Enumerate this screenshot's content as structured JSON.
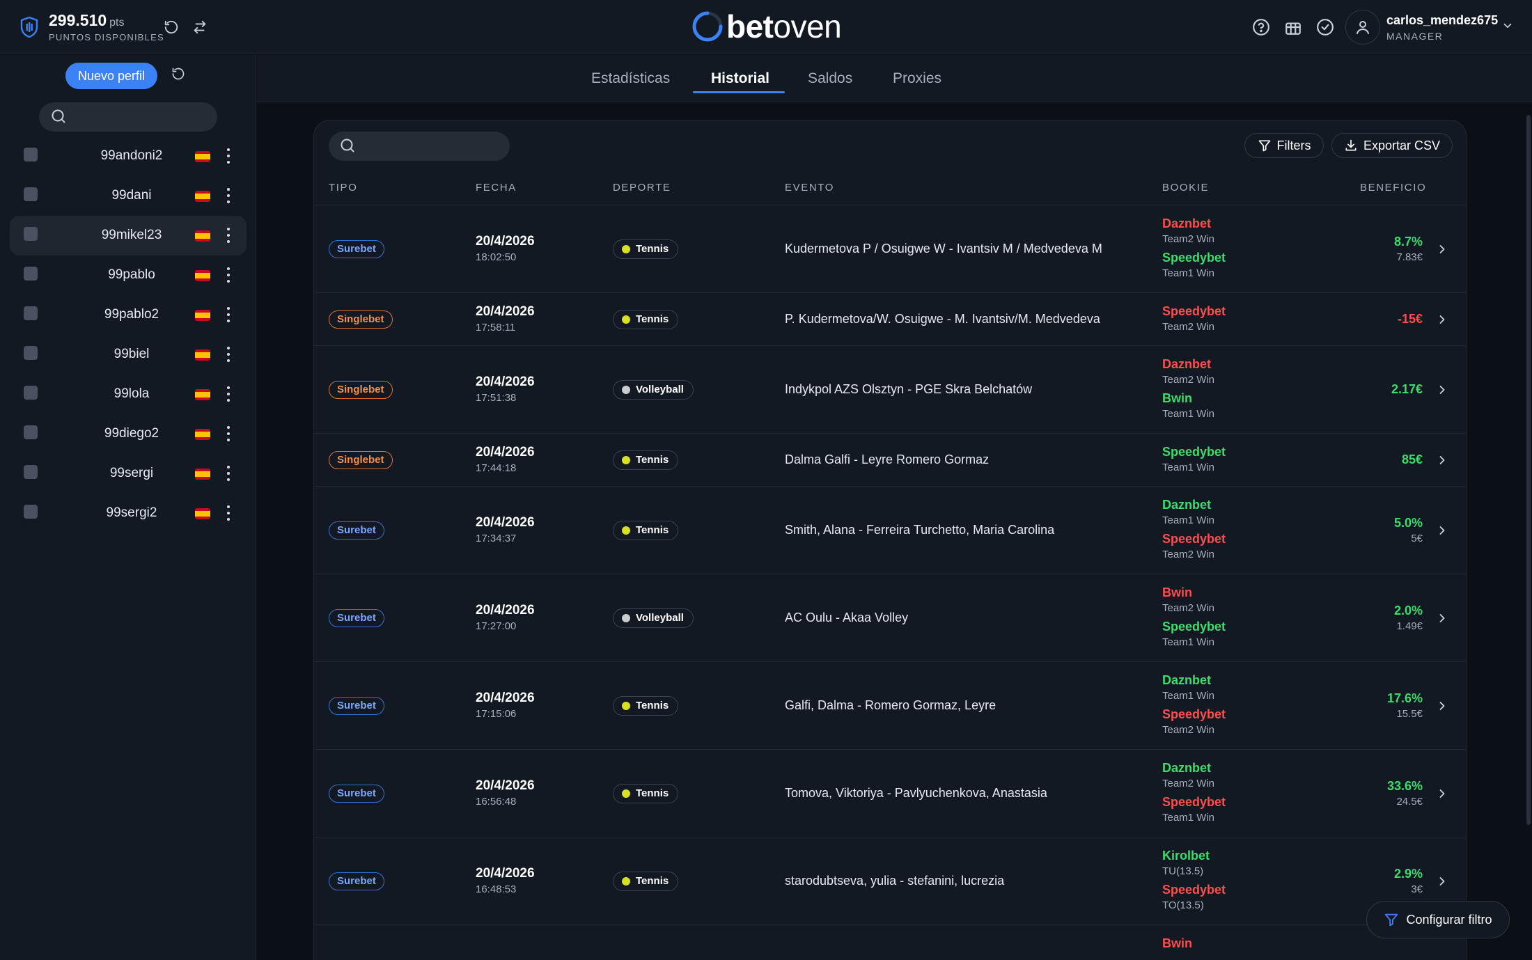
{
  "header": {
    "points_value": "299.510",
    "points_unit": "pts",
    "points_label": "PUNTOS DISPONIBLES",
    "logo_bold": "bet",
    "logo_rest": "oven",
    "user_name": "carlos_mendez675",
    "user_role": "MANAGER"
  },
  "sidebar": {
    "new_profile_label": "Nuevo perfil",
    "search_placeholder": "",
    "profiles": [
      {
        "name": "99andoni2",
        "active": false
      },
      {
        "name": "99dani",
        "active": false
      },
      {
        "name": "99mikel23",
        "active": true
      },
      {
        "name": "99pablo",
        "active": false
      },
      {
        "name": "99pablo2",
        "active": false
      },
      {
        "name": "99biel",
        "active": false
      },
      {
        "name": "99lola",
        "active": false
      },
      {
        "name": "99diego2",
        "active": false
      },
      {
        "name": "99sergi",
        "active": false
      },
      {
        "name": "99sergi2",
        "active": false
      }
    ]
  },
  "tabs": [
    {
      "label": "Estadísticas",
      "active": false
    },
    {
      "label": "Historial",
      "active": true
    },
    {
      "label": "Saldos",
      "active": false
    },
    {
      "label": "Proxies",
      "active": false
    }
  ],
  "toolbar": {
    "search_placeholder": "",
    "filters_label": "Filters",
    "export_label": "Exportar CSV"
  },
  "table": {
    "headers": {
      "tipo": "TIPO",
      "fecha": "FECHA",
      "deporte": "DEPORTE",
      "evento": "EVENTO",
      "bookie": "BOOKIE",
      "beneficio": "BENEFICIO"
    },
    "rows": [
      {
        "type": "Surebet",
        "date": "20/4/2026",
        "time": "18:02:50",
        "sport": "Tennis",
        "event": "Kudermetova P / Osuigwe W - Ivantsiv M / Medvedeva M",
        "bookies": [
          {
            "name": "Daznbet",
            "pick": "Team2 Win",
            "color": "red"
          },
          {
            "name": "Speedybet",
            "pick": "Team1 Win",
            "color": "green"
          }
        ],
        "profit": "8.7%",
        "profit_color": "green",
        "profit_sub": "7.83€"
      },
      {
        "type": "Singlebet",
        "date": "20/4/2026",
        "time": "17:58:11",
        "sport": "Tennis",
        "event": "P. Kudermetova/W. Osuigwe - M. Ivantsiv/M. Medvedeva",
        "bookies": [
          {
            "name": "Speedybet",
            "pick": "Team2 Win",
            "color": "red"
          }
        ],
        "profit": "-15€",
        "profit_color": "red",
        "profit_sub": ""
      },
      {
        "type": "Singlebet",
        "date": "20/4/2026",
        "time": "17:51:38",
        "sport": "Volleyball",
        "event": "Indykpol AZS Olsztyn - PGE Skra Belchatów",
        "bookies": [
          {
            "name": "Daznbet",
            "pick": "Team2 Win",
            "color": "red"
          },
          {
            "name": "Bwin",
            "pick": "Team1 Win",
            "color": "green"
          }
        ],
        "profit": "2.17€",
        "profit_color": "green",
        "profit_sub": ""
      },
      {
        "type": "Singlebet",
        "date": "20/4/2026",
        "time": "17:44:18",
        "sport": "Tennis",
        "event": "Dalma Galfi - Leyre Romero Gormaz",
        "bookies": [
          {
            "name": "Speedybet",
            "pick": "Team1 Win",
            "color": "green"
          }
        ],
        "profit": "85€",
        "profit_color": "green",
        "profit_sub": ""
      },
      {
        "type": "Surebet",
        "date": "20/4/2026",
        "time": "17:34:37",
        "sport": "Tennis",
        "event": "Smith, Alana - Ferreira Turchetto, Maria Carolina",
        "bookies": [
          {
            "name": "Daznbet",
            "pick": "Team1 Win",
            "color": "green"
          },
          {
            "name": "Speedybet",
            "pick": "Team2 Win",
            "color": "red"
          }
        ],
        "profit": "5.0%",
        "profit_color": "green",
        "profit_sub": "5€"
      },
      {
        "type": "Surebet",
        "date": "20/4/2026",
        "time": "17:27:00",
        "sport": "Volleyball",
        "event": "AC Oulu - Akaa Volley",
        "bookies": [
          {
            "name": "Bwin",
            "pick": "Team2 Win",
            "color": "red"
          },
          {
            "name": "Speedybet",
            "pick": "Team1 Win",
            "color": "green"
          }
        ],
        "profit": "2.0%",
        "profit_color": "green",
        "profit_sub": "1.49€"
      },
      {
        "type": "Surebet",
        "date": "20/4/2026",
        "time": "17:15:06",
        "sport": "Tennis",
        "event": "Galfi, Dalma - Romero Gormaz, Leyre",
        "bookies": [
          {
            "name": "Daznbet",
            "pick": "Team1 Win",
            "color": "green"
          },
          {
            "name": "Speedybet",
            "pick": "Team2 Win",
            "color": "red"
          }
        ],
        "profit": "17.6%",
        "profit_color": "green",
        "profit_sub": "15.5€"
      },
      {
        "type": "Surebet",
        "date": "20/4/2026",
        "time": "16:56:48",
        "sport": "Tennis",
        "event": "Tomova, Viktoriya - Pavlyuchenkova, Anastasia",
        "bookies": [
          {
            "name": "Daznbet",
            "pick": "Team2 Win",
            "color": "green"
          },
          {
            "name": "Speedybet",
            "pick": "Team1 Win",
            "color": "red"
          }
        ],
        "profit": "33.6%",
        "profit_color": "green",
        "profit_sub": "24.5€"
      },
      {
        "type": "Surebet",
        "date": "20/4/2026",
        "time": "16:48:53",
        "sport": "Tennis",
        "event": "starodubtseva, yulia - stefanini, lucrezia",
        "bookies": [
          {
            "name": "Kirolbet",
            "pick": "TU(13.5)",
            "color": "green"
          },
          {
            "name": "Speedybet",
            "pick": "TO(13.5)",
            "color": "red"
          }
        ],
        "profit": "2.9%",
        "profit_color": "green",
        "profit_sub": "3€"
      },
      {
        "type": "",
        "date": "",
        "time": "",
        "sport": "",
        "event": "",
        "bookies": [
          {
            "name": "Bwin",
            "pick": "",
            "color": "red"
          }
        ],
        "profit": "",
        "profit_color": "green",
        "profit_sub": ""
      }
    ]
  },
  "floating": {
    "config_filter_label": "Configurar filtro"
  },
  "icons": {
    "points": "shield-bars-icon",
    "refresh": "refresh-icon",
    "swap": "swap-arrows-icon",
    "help": "help-circle-icon",
    "gift": "gift-icon",
    "check": "check-circle-icon",
    "user": "user-icon",
    "search": "search-icon",
    "filter": "filter-funnel-icon",
    "download": "download-icon",
    "chevron": "chevron-right-icon"
  },
  "colors": {
    "accent": "#3b82f6",
    "positive": "#3ddc6b",
    "negative": "#ff4d4d",
    "surebet": "#7ba6ff",
    "singlebet": "#f5904c"
  }
}
